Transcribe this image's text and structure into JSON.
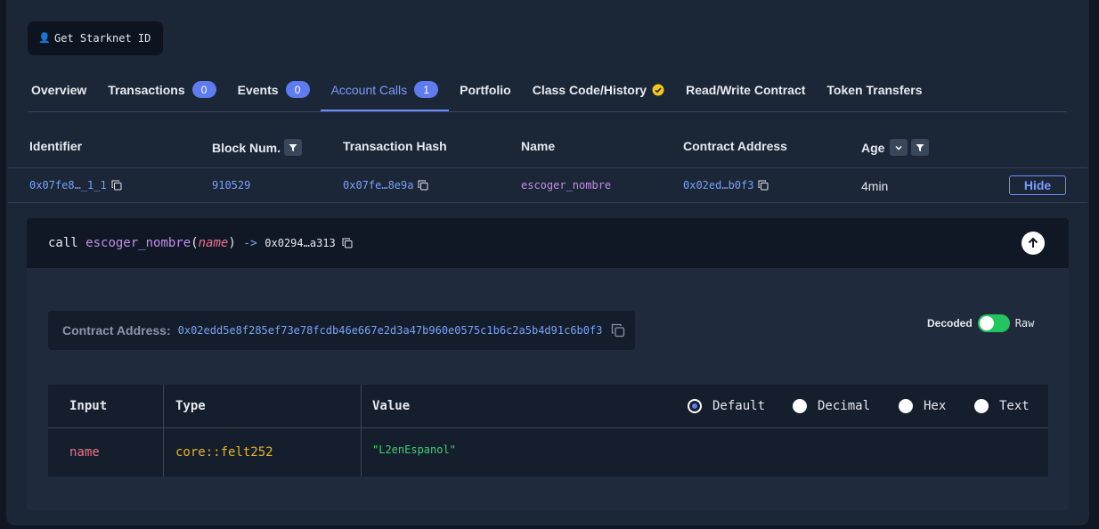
{
  "header": {
    "starknet_button": "Get Starknet ID"
  },
  "tabs": [
    {
      "label": "Overview"
    },
    {
      "label": "Transactions",
      "badge": "0"
    },
    {
      "label": "Events",
      "badge": "0"
    },
    {
      "label": "Account Calls",
      "badge": "1",
      "active": true
    },
    {
      "label": "Portfolio"
    },
    {
      "label": "Class Code/History",
      "verified": true
    },
    {
      "label": "Read/Write Contract"
    },
    {
      "label": "Token Transfers"
    }
  ],
  "table": {
    "columns": {
      "identifier": "Identifier",
      "block_num": "Block Num.",
      "tx_hash": "Transaction Hash",
      "name": "Name",
      "contract_address": "Contract Address",
      "age": "Age"
    },
    "row": {
      "identifier": "0x07fe8…_1_1",
      "block_num": "910529",
      "tx_hash": "0x07fe…8e9a",
      "name": "escoger_nombre",
      "contract_address": "0x02ed…b0f3",
      "age": "4min",
      "hide_label": "Hide"
    }
  },
  "call": {
    "keyword": "call",
    "function": "escoger_nombre",
    "param": "name",
    "arrow": "->",
    "target": "0x0294…a313",
    "contract_label": "Contract Address:",
    "contract_value": "0x02edd5e8f285ef73e78fcdb46e667e2d3a47b960e0575c1b6c2a5b4d91c6b0f3",
    "toggle_on_label": "Decoded",
    "toggle_off_label": "Raw"
  },
  "args": {
    "headers": {
      "input": "Input",
      "type": "Type",
      "value": "Value"
    },
    "formats": [
      "Default",
      "Decimal",
      "Hex",
      "Text"
    ],
    "selected_format": "Default",
    "rows": [
      {
        "input": "name",
        "type": "core::felt252",
        "value": "\"L2enEspanol\""
      }
    ]
  },
  "colors": {
    "accent": "#6b8bff",
    "link": "#7aa2f7",
    "function": "#c48fe8",
    "param": "#f06f8a",
    "type": "#e6b422",
    "string": "#3ecf70",
    "toggle_on": "#23c55e"
  }
}
